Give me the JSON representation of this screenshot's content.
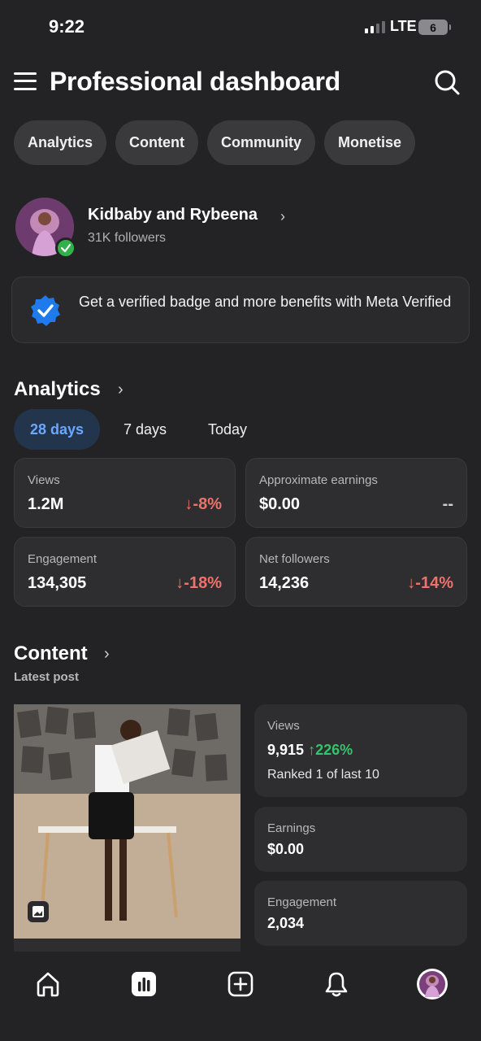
{
  "status_bar": {
    "time": "9:22",
    "network": "LTE",
    "battery": "6"
  },
  "header": {
    "title": "Professional dashboard"
  },
  "tabs": [
    {
      "label": "Analytics"
    },
    {
      "label": "Content"
    },
    {
      "label": "Community"
    },
    {
      "label": "Monetise"
    }
  ],
  "profile": {
    "name": "Kidbaby and Rybeena",
    "followers": "31K followers"
  },
  "banner": {
    "text": "Get a verified badge and more benefits with Meta Verified"
  },
  "analytics": {
    "title": "Analytics",
    "ranges": [
      {
        "label": "28 days",
        "active": true
      },
      {
        "label": "7 days",
        "active": false
      },
      {
        "label": "Today",
        "active": false
      }
    ],
    "cards": [
      {
        "label": "Views",
        "value": "1.2M",
        "change": "↓-8%"
      },
      {
        "label": "Approximate earnings",
        "value": "$0.00",
        "change": "--"
      },
      {
        "label": "Engagement",
        "value": "134,305",
        "change": "↓-18%"
      },
      {
        "label": "Net followers",
        "value": "14,236",
        "change": "↓-14%"
      }
    ]
  },
  "content": {
    "title": "Content",
    "subtitle": "Latest post",
    "stats": {
      "views_label": "Views",
      "views_value": "9,915",
      "views_change": "↑226%",
      "views_rank": "Ranked 1 of last 10",
      "earnings_label": "Earnings",
      "earnings_value": "$0.00",
      "engagement_label": "Engagement",
      "engagement_value": "2,034"
    }
  },
  "bottom_nav": [
    {
      "icon": "home-icon"
    },
    {
      "icon": "dashboard-icon"
    },
    {
      "icon": "create-icon"
    },
    {
      "icon": "bell-icon"
    },
    {
      "icon": "profile-avatar"
    }
  ],
  "colors": {
    "background": "#232325",
    "card": "#2E2E31",
    "accent_blue": "#6BA7FF",
    "negative": "#F0716B",
    "positive": "#35C26A",
    "verified_green": "#2FB24C"
  }
}
